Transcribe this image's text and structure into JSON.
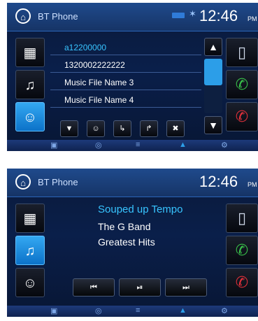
{
  "phone_screen": {
    "title": "BT Phone",
    "time": "12:46",
    "ampm": "PM",
    "contacts": [
      "a12200000",
      "1320002222222",
      "Music File Name 3",
      "Music File Name 4"
    ],
    "icons": {
      "home": "⌂",
      "bluetooth": "✶",
      "apps": "▦",
      "music": "♫",
      "contact": "☺",
      "up": "▲",
      "down": "▼",
      "phone_device": "▯",
      "call": "✆",
      "hangup": "✆",
      "contact_small": "☺",
      "incoming": "↳",
      "outgoing": "↱",
      "missed": "✖"
    }
  },
  "music_screen": {
    "title": "BT Phone",
    "time": "12:46",
    "ampm": "PM",
    "song": "Souped up Tempo",
    "artist": "The G Band",
    "album": "Greatest Hits",
    "controls": {
      "prev": "⏮",
      "play_pause": "⏯",
      "next": "⏭"
    }
  },
  "dock": {
    "icons": [
      "▣",
      "◎",
      "≡",
      "▲",
      "⚙"
    ]
  },
  "colors": {
    "accent": "#2c9ee8",
    "call_green": "#39c04a",
    "hangup_red": "#e0303a"
  }
}
